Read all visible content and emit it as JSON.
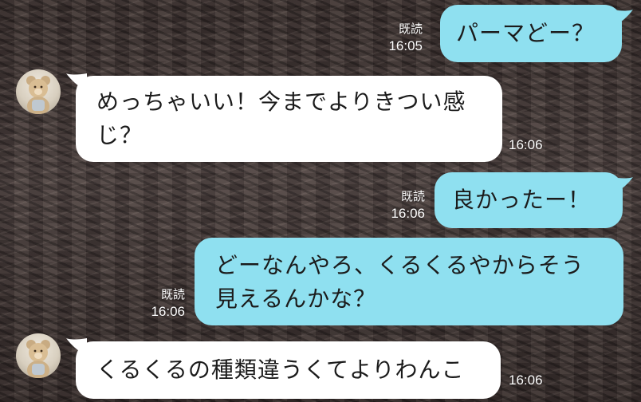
{
  "messages": [
    {
      "side": "out",
      "text": "パーマどー？",
      "read": "既読",
      "time": "16:05"
    },
    {
      "side": "in",
      "text": "めっちゃいい！今までよりきつい感\nじ？",
      "time": "16:06"
    },
    {
      "side": "out",
      "text": "良かったー！",
      "read": "既読",
      "time": "16:06"
    },
    {
      "side": "out",
      "text": "どーなんやろ、くるくるやからそう\n見えるんかな？",
      "read": "既読",
      "time": "16:06"
    },
    {
      "side": "in",
      "text": "くるくるの種類違うくてよりわんこ",
      "time": "16:06"
    }
  ],
  "colors": {
    "outgoing_bubble": "#8fe0f0",
    "incoming_bubble": "#ffffff"
  },
  "icons": {
    "avatar": "teddy-bear-avatar-icon"
  }
}
